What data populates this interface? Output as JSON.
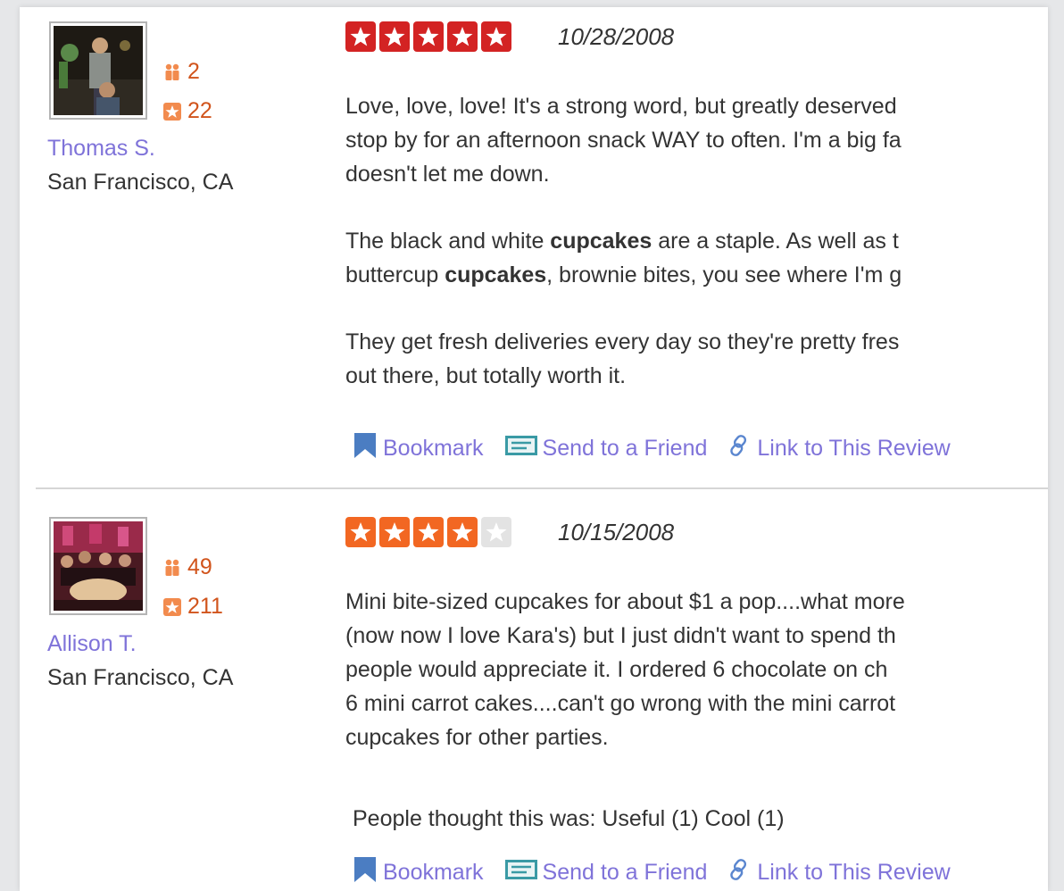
{
  "colors": {
    "star_red": "#d32323",
    "star_orange": "#f26722",
    "star_empty": "#e3e3e3",
    "link": "#7f73d9",
    "stat": "#d1541c",
    "action_blue": "#4b7dc2"
  },
  "icons": {
    "friends": "friends-icon",
    "reviews": "review-count-icon",
    "star": "star-icon",
    "bookmark": "bookmark-icon",
    "send": "envelope-icon",
    "link": "link-icon"
  },
  "reviews": [
    {
      "user": {
        "name": "Thomas S.",
        "location": "San Francisco, CA",
        "friends": "2",
        "review_count": "22"
      },
      "rating": 5,
      "date": "10/28/2008",
      "paragraphs": [
        [
          [
            {
              "t": "Love, love, love! It's a strong word, but greatly deserved"
            }
          ],
          [
            {
              "t": "stop by for an afternoon snack WAY to often. I'm a big fa"
            }
          ],
          [
            {
              "t": "doesn't let me down."
            }
          ]
        ],
        [
          [
            {
              "t": "The black and white "
            },
            {
              "t": "cupcakes",
              "b": true
            },
            {
              "t": " are a staple. As well as t"
            }
          ],
          [
            {
              "t": "buttercup "
            },
            {
              "t": "cupcakes",
              "b": true
            },
            {
              "t": ", brownie bites, you see where I'm g"
            }
          ]
        ],
        [
          [
            {
              "t": "They get fresh deliveries every day so they're pretty fres"
            }
          ],
          [
            {
              "t": "out there, but totally worth it."
            }
          ]
        ]
      ],
      "useful_line": "",
      "actions": {
        "bookmark": "Bookmark",
        "send": "Send to a Friend",
        "link": "Link to This Review"
      }
    },
    {
      "user": {
        "name": "Allison T.",
        "location": "San Francisco, CA",
        "friends": "49",
        "review_count": "211"
      },
      "rating": 4,
      "date": "10/15/2008",
      "paragraphs": [
        [
          [
            {
              "t": "Mini bite-sized cupcakes for about $1 a pop....what more"
            }
          ],
          [
            {
              "t": "(now now I love Kara's) but I just didn't want to spend th"
            }
          ],
          [
            {
              "t": "people would appreciate it.  I ordered 6 chocolate on ch"
            }
          ],
          [
            {
              "t": "6 mini carrot cakes....can't go wrong with the mini carrot"
            }
          ],
          [
            {
              "t": "cupcakes for other parties."
            }
          ]
        ]
      ],
      "useful_line": "People thought this was:  Useful  (1)  Cool  (1)",
      "actions": {
        "bookmark": "Bookmark",
        "send": "Send to a Friend",
        "link": "Link to This Review"
      }
    }
  ]
}
